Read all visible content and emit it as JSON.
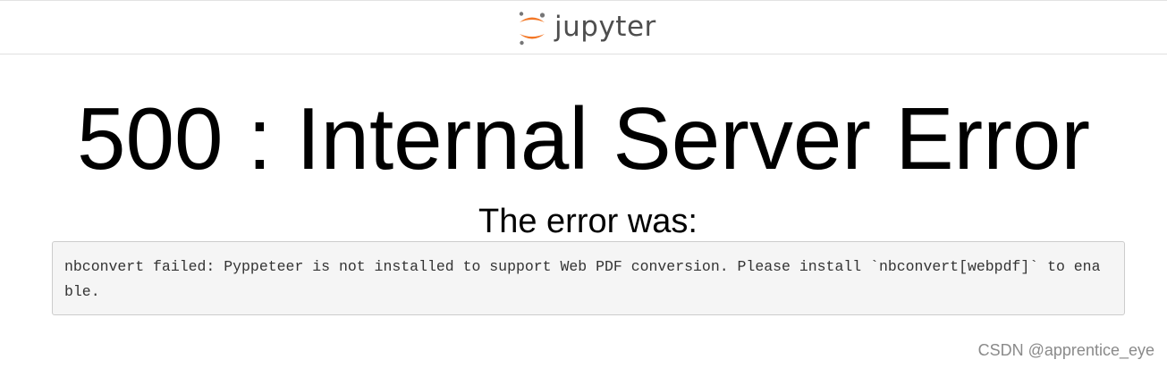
{
  "header": {
    "logo_text": "jupyter",
    "logo_icon": "jupyter-logo-icon",
    "colors": {
      "logo_orange": "#f37726",
      "logo_gray": "#767677",
      "logo_text": "#4e4e4e"
    }
  },
  "error": {
    "title": "500 : Internal Server Error",
    "subtitle": "The error was:",
    "message": "nbconvert failed: Pyppeteer is not installed to support Web PDF conversion. Please install `nbconvert[webpdf]` to enable."
  },
  "watermark": {
    "text": "CSDN @apprentice_eye"
  }
}
